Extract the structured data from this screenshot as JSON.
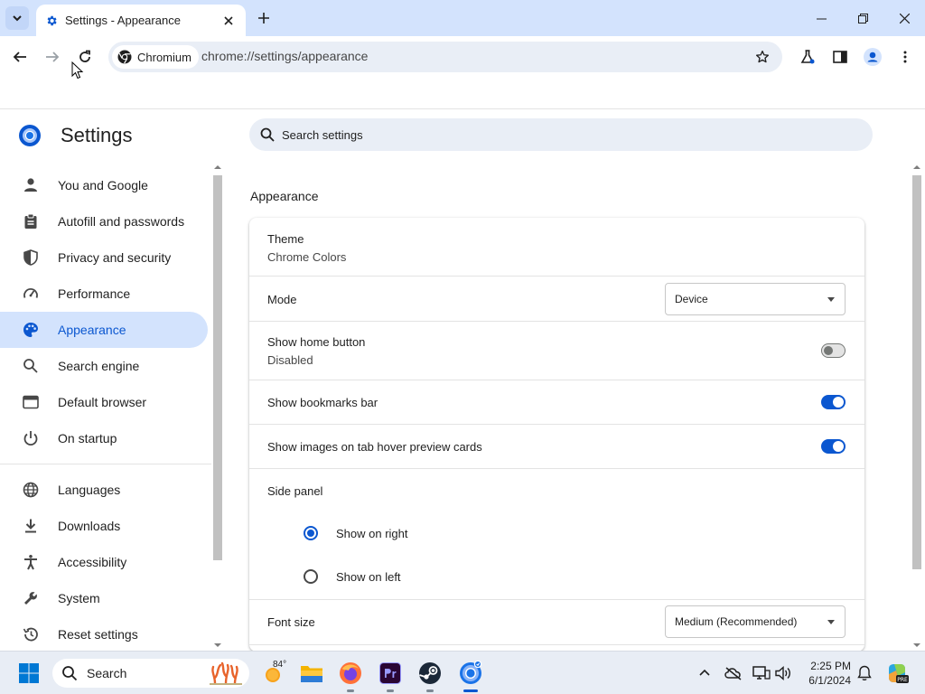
{
  "browser": {
    "tab_title": "Settings - Appearance",
    "site_chip": "Chromium",
    "url": "chrome://settings/appearance"
  },
  "settings": {
    "title": "Settings",
    "search_placeholder": "Search settings",
    "nav": [
      {
        "label": "You and Google",
        "icon": "person-icon"
      },
      {
        "label": "Autofill and passwords",
        "icon": "clipboard-icon"
      },
      {
        "label": "Privacy and security",
        "icon": "shield-icon"
      },
      {
        "label": "Performance",
        "icon": "speedometer-icon"
      },
      {
        "label": "Appearance",
        "icon": "palette-icon",
        "active": true
      },
      {
        "label": "Search engine",
        "icon": "search-icon"
      },
      {
        "label": "Default browser",
        "icon": "browser-window-icon"
      },
      {
        "label": "On startup",
        "icon": "power-icon"
      },
      {
        "label": "Languages",
        "icon": "globe-icon"
      },
      {
        "label": "Downloads",
        "icon": "download-icon"
      },
      {
        "label": "Accessibility",
        "icon": "accessibility-icon"
      },
      {
        "label": "System",
        "icon": "wrench-icon"
      },
      {
        "label": "Reset settings",
        "icon": "history-icon"
      }
    ],
    "appearance": {
      "section_title": "Appearance",
      "theme_label": "Theme",
      "theme_value": "Chrome Colors",
      "mode_label": "Mode",
      "mode_value": "Device",
      "home_button_label": "Show home button",
      "home_button_status": "Disabled",
      "home_button_enabled": false,
      "bookmarks_bar_label": "Show bookmarks bar",
      "bookmarks_bar_enabled": true,
      "tab_hover_label": "Show images on tab hover preview cards",
      "tab_hover_enabled": true,
      "side_panel_label": "Side panel",
      "side_panel_options": [
        "Show on right",
        "Show on left"
      ],
      "side_panel_selected": "Show on right",
      "font_size_label": "Font size",
      "font_size_value": "Medium (Recommended)"
    }
  },
  "taskbar": {
    "search_label": "Search",
    "weather_temp": "84°",
    "time": "2:25 PM",
    "date": "6/1/2024"
  },
  "colors": {
    "accent": "#0b57d0",
    "active_nav_bg": "#d3e3fd",
    "titlebar_bg": "#d3e3fd",
    "omnibox_bg": "#e9eef6"
  }
}
